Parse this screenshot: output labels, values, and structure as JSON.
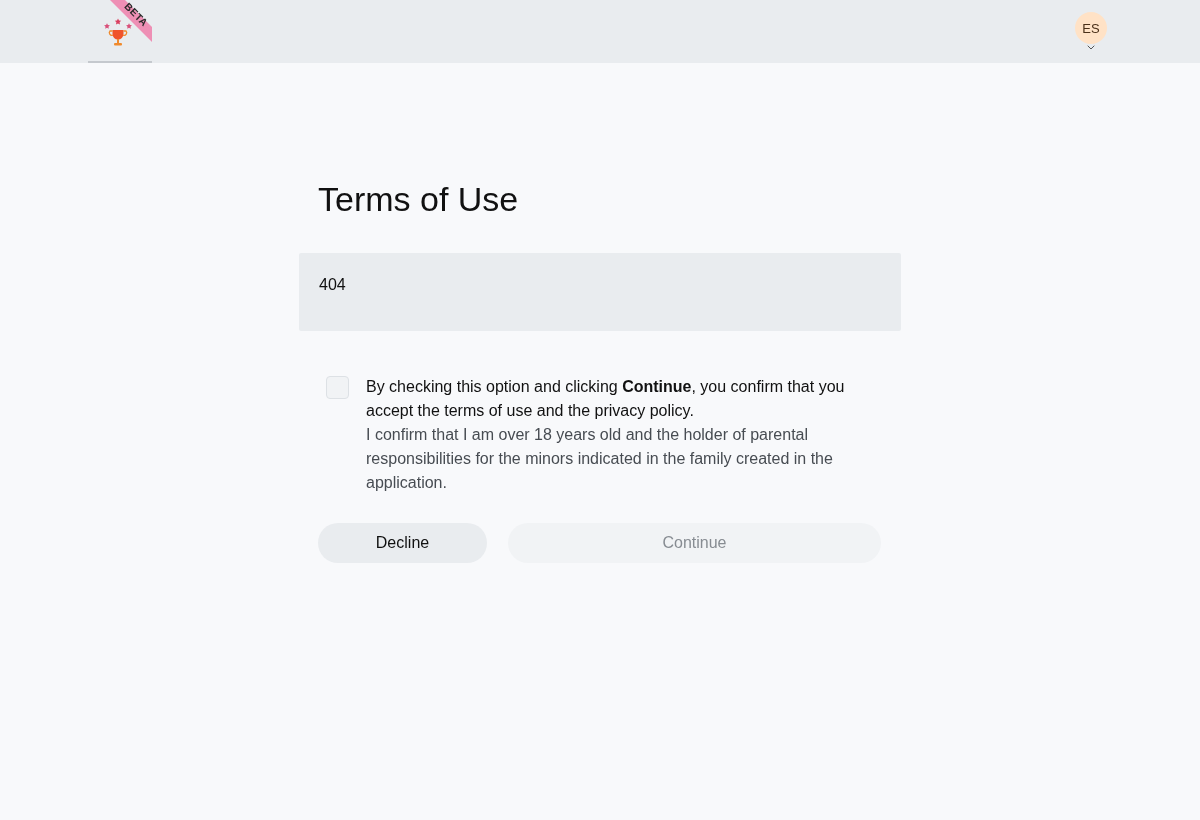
{
  "header": {
    "logo_tab": {
      "badge": "BETA",
      "selected": true
    },
    "avatar": {
      "initials": "ES"
    }
  },
  "title": "Terms of Use",
  "terms_content": "404",
  "consent": {
    "checked": false,
    "text": "By checking this option and clicking **Continue**, you confirm that you accept the terms of use and the privacy policy.",
    "note": "I confirm that I am over 18 years old and the holder of parental responsibilities for the minors indicated in the family created in the application."
  },
  "buttons": [
    {
      "label": "Decline",
      "kind": "secondary",
      "disabled": false
    },
    {
      "label": "Continue",
      "kind": "primary",
      "disabled": true
    }
  ]
}
